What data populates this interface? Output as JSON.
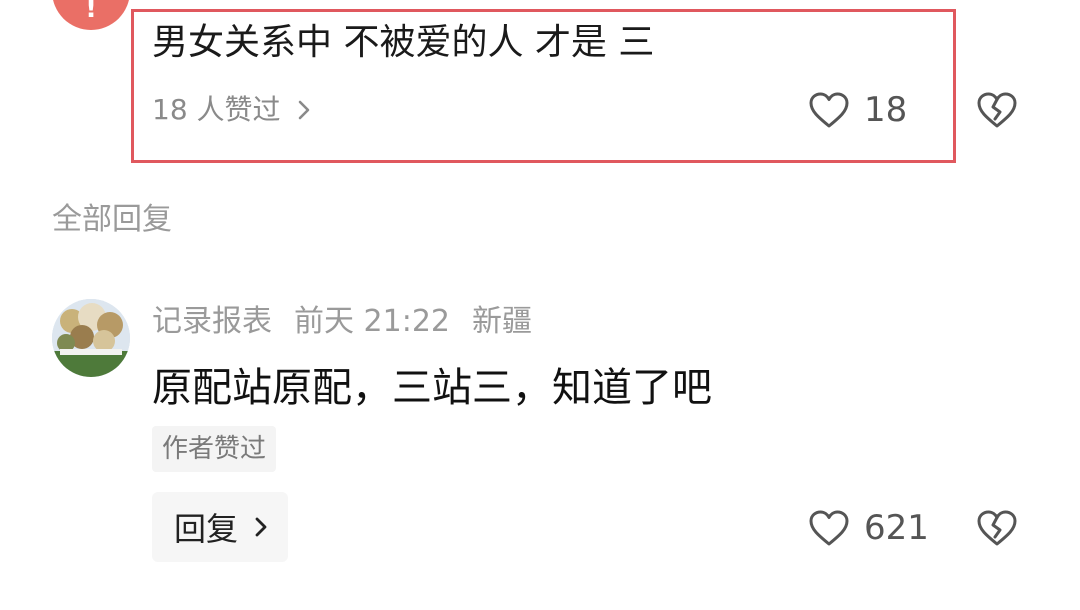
{
  "top_comment": {
    "text": "男女关系中 不被爱的人 才是 三",
    "liked_by": "18 人赞过",
    "like_count": "18"
  },
  "section": {
    "all_replies": "全部回复"
  },
  "reply_comment": {
    "username": "记录报表",
    "time": "前天 21:22",
    "location": "新疆",
    "text": "原配站原配，三站三，知道了吧",
    "author_liked": "作者赞过",
    "reply_label": "回复",
    "like_count": "621"
  },
  "colors": {
    "highlight_border": "#e0585e",
    "top_avatar": "#ea6f66",
    "muted_text": "#9a9a9a"
  },
  "icons": [
    "heart-outline-icon",
    "broken-heart-icon",
    "chevron-right-icon"
  ]
}
